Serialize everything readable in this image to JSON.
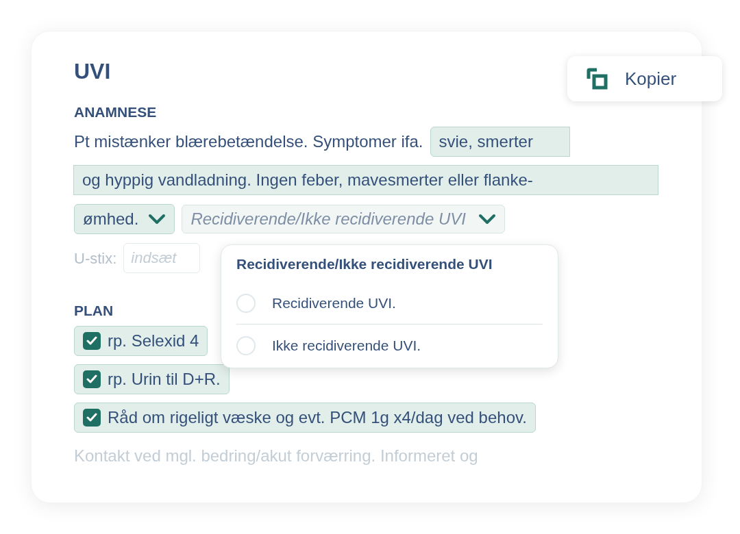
{
  "title": "UVI",
  "copy_button": {
    "label": "Kopier"
  },
  "sections": [
    {
      "heading": "ANAMNESE",
      "intro": "Pt mistænker blærebetændelse. Symptomer ifa.",
      "chip_lines": [
        "svie, smerter",
        "og hyppig vandladning. Ingen feber, mavesmerter eller flanke-",
        "ømhed."
      ],
      "select": {
        "placeholder": "Recidiverende/Ikke recidiverende UVI"
      },
      "field": {
        "label": "U-stix:",
        "placeholder": "indsæt"
      }
    },
    {
      "heading": "PLAN",
      "items": [
        {
          "kind": "checkbox",
          "text": "rp. Selexid 4",
          "checked": true
        },
        {
          "kind": "checkbox",
          "text": "rp. Urin til D+R.",
          "checked": true
        },
        {
          "kind": "checkbox",
          "text": "Råd om rigeligt væske og evt. PCM 1g x4/dag ved behov.",
          "checked": true
        },
        {
          "kind": "text",
          "text": "Kontakt ved mgl. bedring/akut forværring. Informeret og",
          "faded": true
        }
      ]
    }
  ],
  "popup": {
    "title": "Recidiverende/Ikke recidiverende UVI",
    "options": [
      {
        "label": "Recidiverende UVI.",
        "selected": false
      },
      {
        "label": "Ikke recidiverende UVI.",
        "selected": false
      }
    ]
  }
}
